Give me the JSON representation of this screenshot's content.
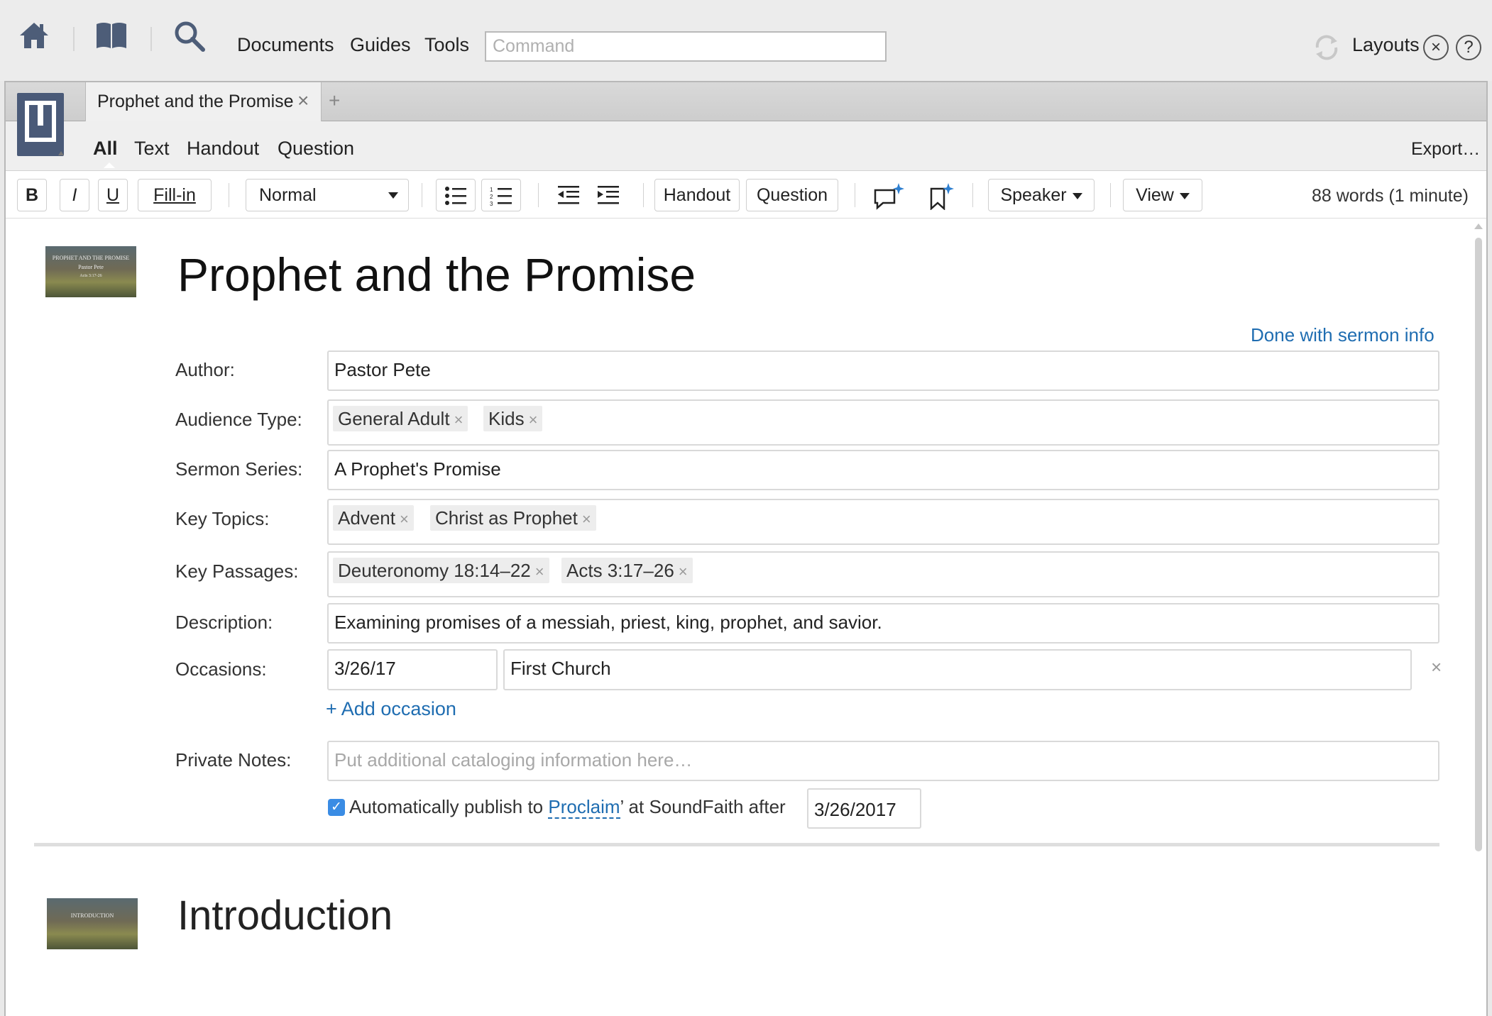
{
  "app": {
    "menu": [
      "Documents",
      "Guides",
      "Tools"
    ],
    "command_placeholder": "Command",
    "layouts_label": "Layouts",
    "close_glyph": "×",
    "help_glyph": "?"
  },
  "tabs": {
    "active_title": "Prophet and the Promise",
    "close_glyph": "×",
    "new_tab_glyph": "+"
  },
  "subnav": {
    "items": [
      "All",
      "Text",
      "Handout",
      "Question"
    ],
    "active": "All",
    "export_label": "Export…"
  },
  "toolbar": {
    "bold": "B",
    "italic": "I",
    "underline": "U",
    "fill_in": "Fill-in",
    "style_value": "Normal",
    "handout": "Handout",
    "question": "Question",
    "speaker": "Speaker",
    "view": "View",
    "word_count": "88 words (1 minute)"
  },
  "sermon": {
    "title": "Prophet and the Promise",
    "done_link": "Done with sermon info",
    "thumb_line1": "PROPHET AND THE PROMISE",
    "thumb_line2": "Pastor Pete",
    "thumb_line3": "Acts 3:17-26",
    "fields": {
      "author_label": "Author:",
      "author_value": "Pastor Pete",
      "audience_label": "Audience Type:",
      "audience_tags": [
        "General Adult",
        "Kids"
      ],
      "series_label": "Sermon Series:",
      "series_value": "A Prophet's Promise",
      "topics_label": "Key Topics:",
      "topics_tags": [
        "Advent",
        "Christ as Prophet"
      ],
      "passages_label": "Key Passages:",
      "passages_tags": [
        "Deuteronomy 18:14–22",
        "Acts 3:17–26"
      ],
      "description_label": "Description:",
      "description_value": "Examining promises of a messiah, priest, king, prophet, and savior.",
      "occasions_label": "Occasions:",
      "occasion_date": "3/26/17",
      "occasion_place": "First Church",
      "occasion_remove": "×",
      "add_occasion": "+ Add occasion",
      "notes_label": "Private Notes:",
      "notes_placeholder": "Put additional cataloging information here…",
      "publish_prefix": "Automatically publish to ",
      "publish_link": "Proclaim",
      "publish_suffix": "’ at SoundFaith after",
      "publish_date": "3/26/2017",
      "publish_checked": "✓"
    }
  },
  "section": {
    "title": "Introduction",
    "thumb_label": "INTRODUCTION"
  },
  "colors": {
    "link": "#1f6db1",
    "checkbox": "#3a8ce4",
    "icon": "#4a5a78"
  }
}
